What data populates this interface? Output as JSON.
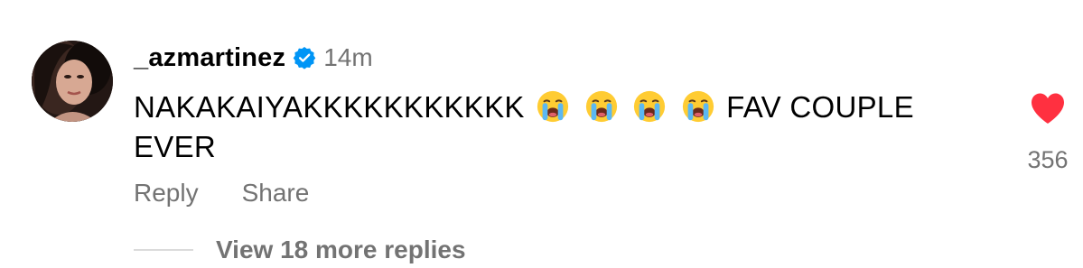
{
  "comment": {
    "author": "_azmartinez",
    "verified_icon": "verified-badge-icon",
    "timestamp": "14m",
    "text_lead": "NAKAKAIYAKKKKKKKKKKK",
    "emoji_icon": "loudly-crying-face-emoji",
    "emoji_count": 4,
    "text_tail": "FAV COUPLE EVER",
    "like_icon": "heart-filled-icon",
    "like_count": "356",
    "actions": {
      "reply_label": "Reply",
      "share_label": "Share"
    },
    "view_replies_label": "View 18 more replies"
  },
  "colors": {
    "text_primary": "#000000",
    "text_secondary": "#737373",
    "verified_blue": "#0095f6",
    "heart_red": "#ff3040",
    "divider": "#dbdbdb"
  }
}
